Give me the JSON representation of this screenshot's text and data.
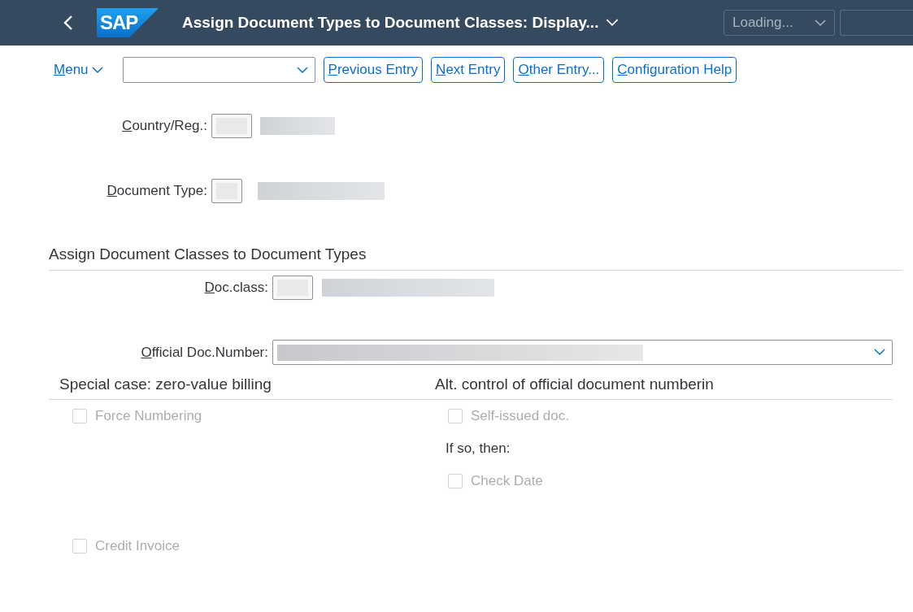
{
  "shell": {
    "logo": "SAP",
    "title": "Assign Document Types to Document Classes: Display...",
    "status_dropdown": "Loading..."
  },
  "toolbar": {
    "menu": "Menu",
    "buttons": [
      "Previous Entry",
      "Next Entry",
      "Other Entry...",
      "Configuration Help"
    ]
  },
  "header_fields": [
    {
      "label": "Country/Reg.:"
    },
    {
      "label": "Document Type:"
    }
  ],
  "section": {
    "title": "Assign Document Classes to Document Types",
    "fields": [
      {
        "label": "Doc.class:",
        "kind": "input"
      },
      {
        "label": "Official Doc.Number:",
        "kind": "dropdown"
      }
    ]
  },
  "groups": [
    {
      "title": "Special case: zero-value billing",
      "items": [
        {
          "kind": "checkbox",
          "label": "Force Numbering",
          "checked": false,
          "disabled": true
        },
        {
          "kind": "checkbox",
          "label": "Credit Invoice",
          "checked": false,
          "disabled": true
        }
      ]
    },
    {
      "title": "Alt. control of official document numberin",
      "items": [
        {
          "kind": "checkbox",
          "label": "Self-issued doc.",
          "checked": false,
          "disabled": true
        },
        {
          "kind": "text",
          "label": "If so, then:"
        },
        {
          "kind": "checkbox",
          "label": "Check Date",
          "checked": false,
          "disabled": true
        }
      ]
    }
  ]
}
